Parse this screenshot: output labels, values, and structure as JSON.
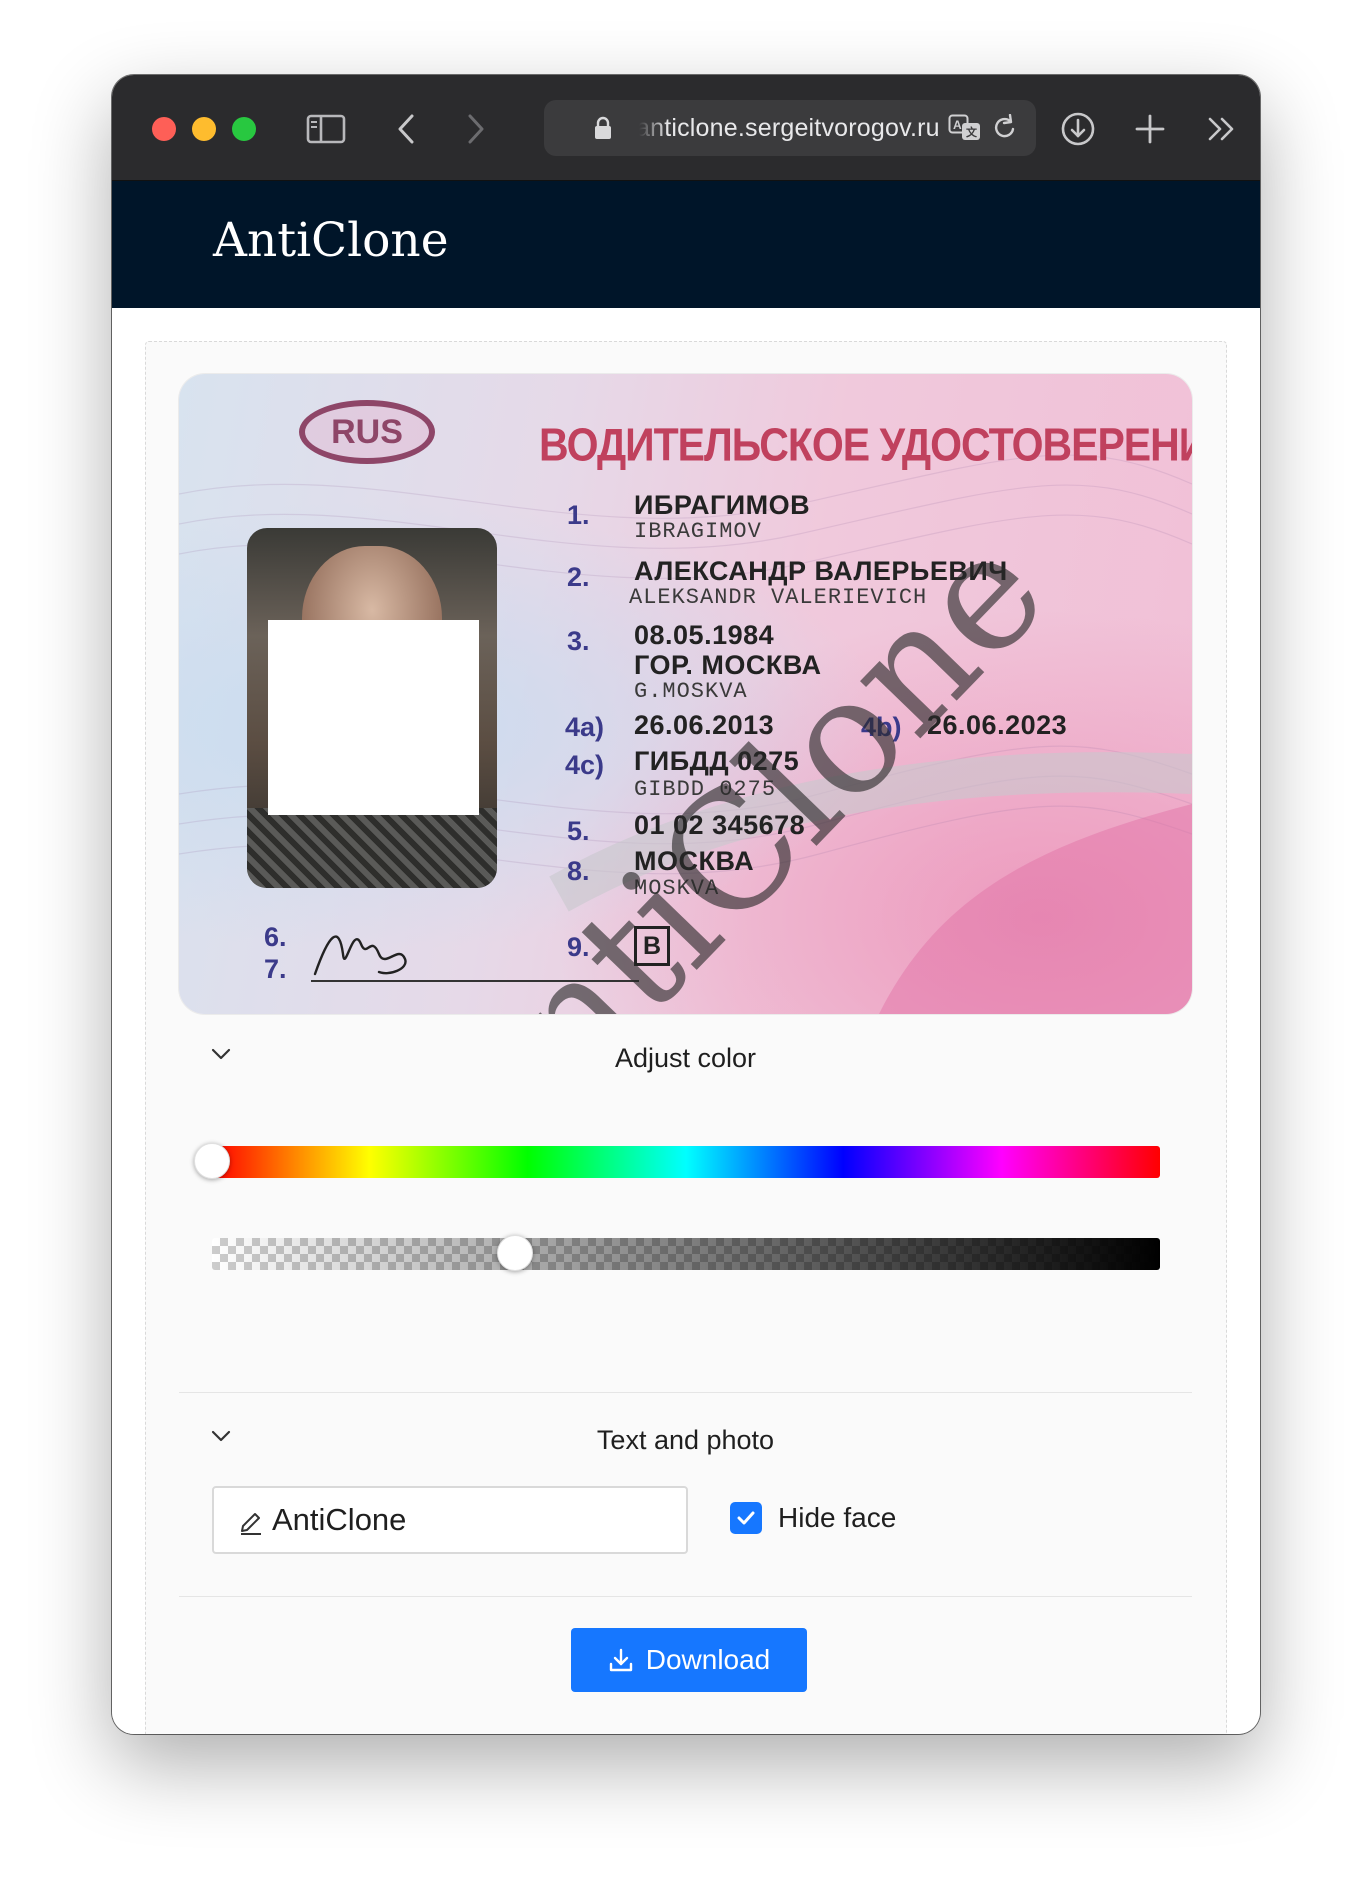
{
  "browser": {
    "url": "anticlone.sergeitvorogov.ru",
    "icons": [
      "sidebar-icon",
      "back-icon",
      "forward-icon",
      "lock-icon",
      "translate-icon",
      "reload-icon",
      "downloads-icon",
      "new-tab-icon",
      "more-icon"
    ]
  },
  "app": {
    "brand": "AntiClone"
  },
  "license": {
    "country": "RUS",
    "title": "ВОДИТЕЛЬСКОЕ УДОСТОВЕРЕНИЕ",
    "fields": [
      {
        "num": "1.",
        "value": "ИБРАГИМОВ",
        "latin": "IBRAGIMOV"
      },
      {
        "num": "2.",
        "value": "АЛЕКСАНДР ВАЛЕРЬЕВИЧ",
        "latin": "ALEKSANDR VALERIEVICH"
      },
      {
        "num": "3.",
        "value": "08.05.1984",
        "value2": "ГОР. МОСКВА",
        "latin": "G.MOSKVA"
      },
      {
        "num": "4a)",
        "value": "26.06.2013",
        "num2": "4b)",
        "value2": "26.06.2023"
      },
      {
        "num": "4c)",
        "value": "ГИБДД 0275",
        "latin": "GIBDD 0275"
      },
      {
        "num": "5.",
        "value": "01 02 345678"
      },
      {
        "num": "8.",
        "value": "МОСКВА",
        "latin": "MOSKVA"
      },
      {
        "num": "9.",
        "value": "B"
      }
    ],
    "sig_nums": [
      "6.",
      "7."
    ],
    "watermark": "AntiClone"
  },
  "adjust_color": {
    "title": "Adjust color",
    "hue_value": 0,
    "alpha_value": 0.32
  },
  "text_photo": {
    "title": "Text and photo",
    "input_value": "AntiClone",
    "hide_face_label": "Hide face",
    "hide_face_checked": true
  },
  "actions": {
    "download_label": "Download"
  },
  "colors": {
    "header_bg": "#001529",
    "primary": "#1677ff"
  }
}
